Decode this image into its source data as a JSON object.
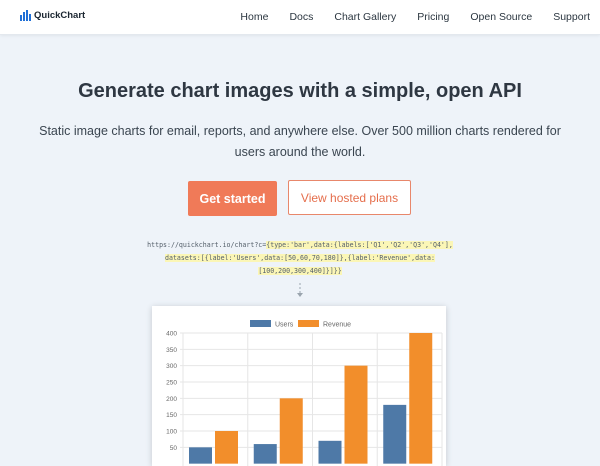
{
  "nav": {
    "brand": "QuickChart",
    "links": [
      "Home",
      "Docs",
      "Chart Gallery",
      "Pricing",
      "Open Source",
      "Support"
    ]
  },
  "hero": {
    "headline": "Generate chart images with a simple, open API",
    "subline": "Static image charts for email, reports, and anywhere else. Over 500 million charts rendered for users around the world.",
    "primary_button": "Get started",
    "secondary_button": "View hosted plans"
  },
  "code_example": {
    "prefix": "https://quickchart.io/chart?c=",
    "line1_highlight": "{type:'bar',data:{labels:['Q1','Q2','Q3','Q4'],",
    "line2": "datasets:[{label:'Users',data:[50,60,70,180]},{label:'Revenue',data:",
    "line3": "[100,200,300,400]}]}}"
  },
  "colors": {
    "accent": "#f07a58",
    "users": "#4e79a7",
    "revenue": "#f28e2b",
    "brand": "#1f6fd6"
  },
  "chart_data": {
    "type": "bar",
    "categories": [
      "Q1",
      "Q2",
      "Q3",
      "Q4"
    ],
    "series": [
      {
        "name": "Users",
        "values": [
          50,
          60,
          70,
          180
        ]
      },
      {
        "name": "Revenue",
        "values": [
          100,
          200,
          300,
          400
        ]
      }
    ],
    "ylim": [
      0,
      400
    ],
    "yticks": [
      50,
      100,
      150,
      200,
      250,
      300,
      350,
      400
    ],
    "grid": true,
    "legend": "top"
  }
}
